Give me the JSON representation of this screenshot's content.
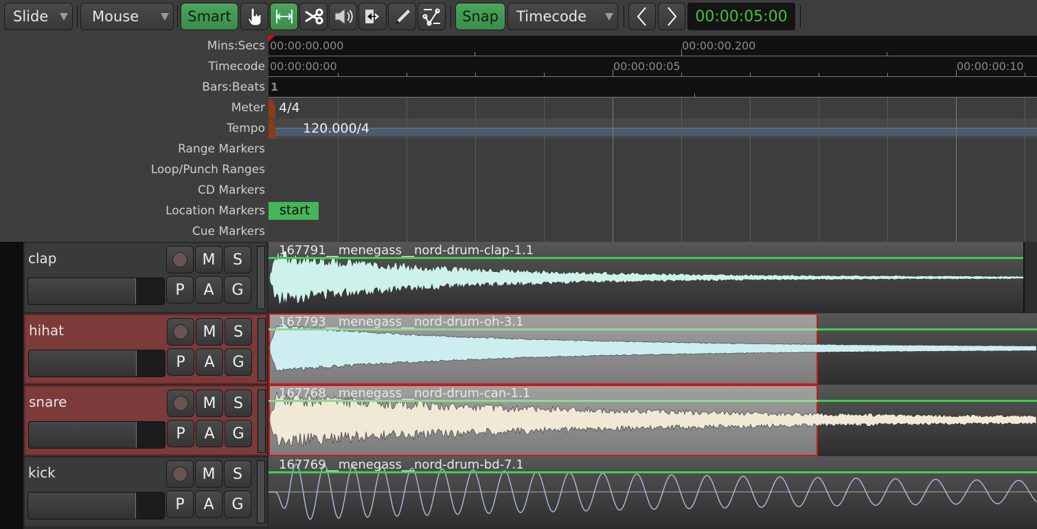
{
  "toolbar": {
    "edit_mode": "Slide",
    "mouse_mode": "Mouse",
    "smart_label": "Smart",
    "tools": [
      {
        "name": "grab-tool",
        "icon": "hand-icon",
        "active": false
      },
      {
        "name": "range-tool",
        "icon": "range-arrows-icon",
        "active": true
      },
      {
        "name": "cut-tool",
        "icon": "scissors-icon",
        "active": false
      },
      {
        "name": "audition-tool",
        "icon": "speaker-icon",
        "active": false
      },
      {
        "name": "stretch-tool",
        "icon": "stretch-icon",
        "active": false
      },
      {
        "name": "draw-tool",
        "icon": "pencil-icon",
        "active": false
      },
      {
        "name": "internal-edit-tool",
        "icon": "automation-edit-icon",
        "active": false
      }
    ],
    "snap_label": "Snap",
    "grid_type": "Timecode",
    "nudge_back_icon": "chevron-left-icon",
    "nudge_forward_icon": "chevron-right-icon",
    "nudge_clock": "00:00:05:00"
  },
  "rulers": {
    "labels": [
      "Mins:Secs",
      "Timecode",
      "Bars:Beats",
      "Meter",
      "Tempo",
      "Range Markers",
      "Loop/Punch Ranges",
      "CD Markers",
      "Location Markers",
      "Cue Markers"
    ],
    "minsec": [
      {
        "text": "00:00:00.000",
        "t": 0
      },
      {
        "text": "00:00:00.200",
        "t": 0.2
      }
    ],
    "timecode": [
      {
        "text": "00:00:00:00",
        "f": 0
      },
      {
        "text": "00:00:00:05",
        "f": 5
      },
      {
        "text": "00:00:00:10",
        "f": 10
      }
    ],
    "bbt": "1",
    "meter": "4/4",
    "tempo": "120.000/4",
    "location_marker": "start"
  },
  "tracks": [
    {
      "name": "clap",
      "selected": false,
      "buttons": {
        "rec": "",
        "mute": "M",
        "solo": "S",
        "playlist": "P",
        "automation": "A",
        "group": "G"
      },
      "fader": 0.79,
      "region": {
        "name": "167791__menegass__nord-drum-clap-1.1",
        "selected": false,
        "wave_color": "#cdf2ea",
        "kind": "clap",
        "end_frac": 0.982
      }
    },
    {
      "name": "hihat",
      "selected": true,
      "buttons": {
        "rec": "",
        "mute": "M",
        "solo": "S",
        "playlist": "P",
        "automation": "A",
        "group": "G"
      },
      "fader": 0.79,
      "region": {
        "name": "167793__menegass__nord-drum-oh-3.1",
        "selected": true,
        "wave_color": "#cdeef0",
        "kind": "hihat",
        "end_frac": 0.715
      }
    },
    {
      "name": "snare",
      "selected": true,
      "buttons": {
        "rec": "",
        "mute": "M",
        "solo": "S",
        "playlist": "P",
        "automation": "A",
        "group": "G"
      },
      "fader": 0.79,
      "region": {
        "name": "167768__menegass__nord-drum-can-1.1",
        "selected": true,
        "wave_color": "#efe9d6",
        "kind": "snare",
        "end_frac": 0.715
      }
    },
    {
      "name": "kick",
      "selected": false,
      "buttons": {
        "rec": "",
        "mute": "M",
        "solo": "S",
        "playlist": "P",
        "automation": "A",
        "group": "G"
      },
      "fader": 0.79,
      "region": {
        "name": "167769__menegass__nord-drum-bd-7.1",
        "selected": false,
        "wave_color": "#a9b6d6",
        "kind": "kick",
        "end_frac": 1.0
      }
    }
  ],
  "colors": {
    "accent_green": "#45a857",
    "clock_text": "#45c23a",
    "selection_red": "#c81818",
    "gain_line": "#3fcf4f",
    "meter_marker": "#8a3c14",
    "tempo_bar": "#4c5a6e",
    "location_marker": "#45b55a"
  }
}
